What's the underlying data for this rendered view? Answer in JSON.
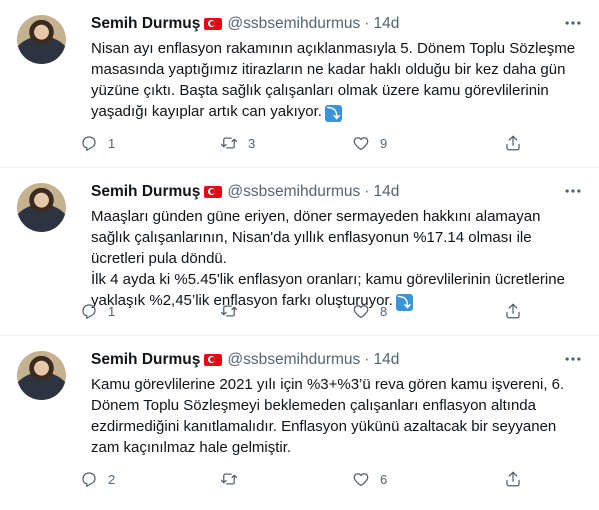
{
  "tweets": [
    {
      "name": "Semih Durmuş",
      "handle": "@ssbsemihdurmus",
      "dot": "·",
      "time": "14d",
      "text": [
        "Nisan ayı enflasyon rakamının açıklanmasıyla 5. Dönem Toplu Sözleşme masasında yaptığımız itirazların ne kadar haklı olduğu bir kez daha gün yüzüne çıktı. Başta sağlık çalışanları olmak üzere kamu görevlilerinin yaşadığı kayıplar artık can yakıyor."
      ],
      "has_arrow": true,
      "replies": "1",
      "retweets": "3",
      "likes": "9"
    },
    {
      "name": "Semih Durmuş",
      "handle": "@ssbsemihdurmus",
      "dot": "·",
      "time": "14d",
      "text": [
        "Maaşları günden güne eriyen, döner sermayeden hakkını alamayan sağlık çalışanlarının, Nisan'da yıllık enflasyonun %17.14 olması ile ücretleri pula döndü.",
        "İlk 4 ayda ki %5.45'lik enflasyon oranları; kamu görevlilerinin ücretlerine yaklaşık %2,45’lik enflasyon farkı oluşturuyor."
      ],
      "has_arrow": true,
      "replies": "1",
      "retweets": "",
      "likes": "8"
    },
    {
      "name": "Semih Durmuş",
      "handle": "@ssbsemihdurmus",
      "dot": "·",
      "time": "14d",
      "text": [
        "Kamu görevlilerine 2021 yılı için %3+%3’ü reva gören kamu işvereni, 6. Dönem Toplu Sözleşmeyi beklemeden çalışanları enflasyon altında ezdirmediğini kanıtlamalıdır. Enflasyon yükünü azaltacak bir seyyanen zam kaçınılmaz hale gelmiştir."
      ],
      "has_arrow": false,
      "replies": "2",
      "retweets": "",
      "likes": "6"
    }
  ],
  "icons": {
    "reply": "reply-icon",
    "retweet": "retweet-icon",
    "like": "heart-icon",
    "share": "share-icon",
    "more": "more-icon",
    "flag": "turkey-flag-icon",
    "arrow": "arrow-down-right-icon"
  },
  "colors": {
    "muted": "#536471",
    "text": "#0f1419",
    "divider": "#eff3f4",
    "arrow_badge": "#3b94d9",
    "flag_red": "#e30a17"
  }
}
